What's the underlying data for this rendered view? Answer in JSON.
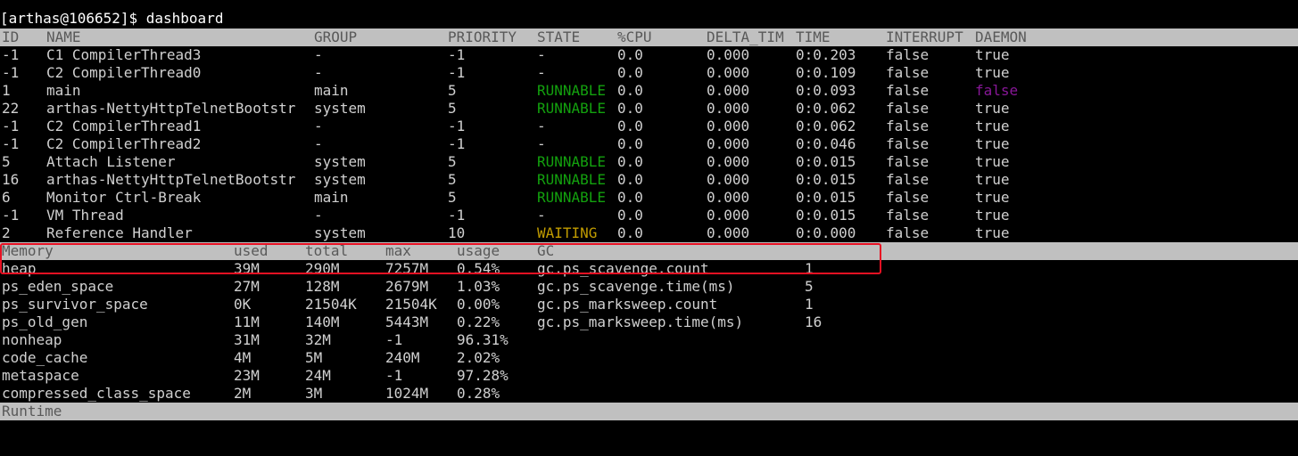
{
  "prompt": "[arthas@106652]$ dashboard",
  "threads": {
    "headers": [
      "ID",
      "NAME",
      "GROUP",
      "PRIORITY",
      "STATE",
      "%CPU",
      "DELTA_TIM",
      "TIME",
      "INTERRUPT",
      "DAEMON"
    ],
    "rows": [
      [
        "-1",
        "C1 CompilerThread3",
        "-",
        "-1",
        "-",
        "0.0",
        "0.000",
        "0:0.203",
        "false",
        "true"
      ],
      [
        "-1",
        "C2 CompilerThread0",
        "-",
        "-1",
        "-",
        "0.0",
        "0.000",
        "0:0.109",
        "false",
        "true"
      ],
      [
        "1",
        "main",
        "main",
        "5",
        "RUNNABLE",
        "0.0",
        "0.000",
        "0:0.093",
        "false",
        "false"
      ],
      [
        "22",
        "arthas-NettyHttpTelnetBootstr",
        "system",
        "5",
        "RUNNABLE",
        "0.0",
        "0.000",
        "0:0.062",
        "false",
        "true"
      ],
      [
        "-1",
        "C2 CompilerThread1",
        "-",
        "-1",
        "-",
        "0.0",
        "0.000",
        "0:0.062",
        "false",
        "true"
      ],
      [
        "-1",
        "C2 CompilerThread2",
        "-",
        "-1",
        "-",
        "0.0",
        "0.000",
        "0:0.046",
        "false",
        "true"
      ],
      [
        "5",
        "Attach Listener",
        "system",
        "5",
        "RUNNABLE",
        "0.0",
        "0.000",
        "0:0.015",
        "false",
        "true"
      ],
      [
        "16",
        "arthas-NettyHttpTelnetBootstr",
        "system",
        "5",
        "RUNNABLE",
        "0.0",
        "0.000",
        "0:0.015",
        "false",
        "true"
      ],
      [
        "6",
        "Monitor Ctrl-Break",
        "main",
        "5",
        "RUNNABLE",
        "0.0",
        "0.000",
        "0:0.015",
        "false",
        "true"
      ],
      [
        "-1",
        "VM Thread",
        "-",
        "-1",
        "-",
        "0.0",
        "0.000",
        "0:0.015",
        "false",
        "true"
      ],
      [
        "2",
        "Reference Handler",
        "system",
        "10",
        "WAITING",
        "0.0",
        "0.000",
        "0:0.000",
        "false",
        "true"
      ]
    ]
  },
  "memory": {
    "headers": [
      "Memory",
      "used",
      "total",
      "max",
      "usage",
      "GC"
    ],
    "rows": [
      [
        "heap",
        "39M",
        "290M",
        "7257M",
        "0.54%",
        "gc.ps_scavenge.count",
        "1"
      ],
      [
        "ps_eden_space",
        "27M",
        "128M",
        "2679M",
        "1.03%",
        "gc.ps_scavenge.time(ms)",
        "5"
      ],
      [
        "ps_survivor_space",
        "0K",
        "21504K",
        "21504K",
        "0.00%",
        "gc.ps_marksweep.count",
        "1"
      ],
      [
        "ps_old_gen",
        "11M",
        "140M",
        "5443M",
        "0.22%",
        "gc.ps_marksweep.time(ms)",
        "16"
      ],
      [
        "nonheap",
        "31M",
        "32M",
        "-1",
        "96.31%",
        "",
        ""
      ],
      [
        "code_cache",
        "4M",
        "5M",
        "240M",
        "2.02%",
        "",
        ""
      ],
      [
        "metaspace",
        "23M",
        "24M",
        "-1",
        "97.28%",
        "",
        ""
      ],
      [
        "compressed_class_space",
        "2M",
        "3M",
        "1024M",
        "0.28%",
        "",
        ""
      ]
    ]
  },
  "runtime": {
    "label": "Runtime"
  },
  "colors": {
    "background": "#000000",
    "text": "#d0d0d0",
    "header_bg": "#c0c0c0",
    "runnable": "#13a10e",
    "waiting": "#c19c00",
    "daemon_false": "#881798",
    "highlight_box": "#e81123"
  }
}
